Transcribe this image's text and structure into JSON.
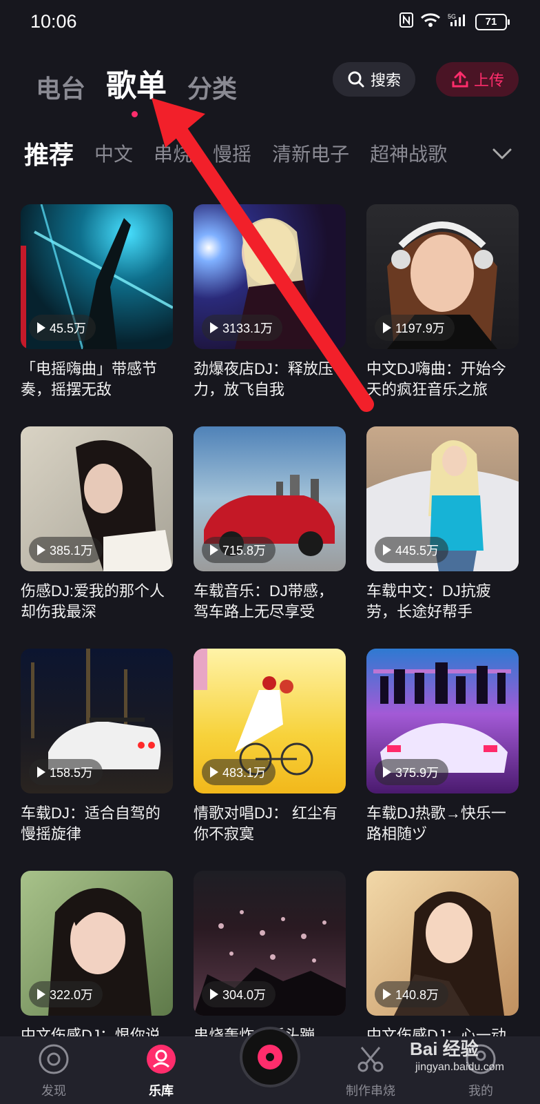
{
  "status": {
    "time": "10:06",
    "battery": "71"
  },
  "top_tabs": [
    "电台",
    "歌单",
    "分类"
  ],
  "search_label": "搜索",
  "upload_label": "上传",
  "categories": [
    "推荐",
    "中文",
    "串烧",
    "慢摇",
    "清新电子",
    "超神战歌"
  ],
  "cards": [
    {
      "count": "45.5万",
      "title": "「电摇嗨曲」带感节奏，摇摆无敌"
    },
    {
      "count": "3133.1万",
      "title": "劲爆夜店DJ：释放压力，放飞自我"
    },
    {
      "count": "1197.9万",
      "title": "中文DJ嗨曲：开始今天的疯狂音乐之旅"
    },
    {
      "count": "385.1万",
      "title": "伤感DJ:爱我的那个人却伤我最深"
    },
    {
      "count": "715.8万",
      "title": "车载音乐：DJ带感，驾车路上无尽享受"
    },
    {
      "count": "445.5万",
      "title": "车载中文：DJ抗疲劳，长途好帮手"
    },
    {
      "count": "158.5万",
      "title": "车载DJ：适合自驾的慢摇旋律"
    },
    {
      "count": "483.1万",
      "title": "情歌对唱DJ：  红尘有你不寂寞"
    },
    {
      "count": "375.9万",
      "title": "车载DJ热歌→快乐一路相随ヅ"
    },
    {
      "count": "322.0万",
      "title": "中文伤感DJ：恨你说"
    },
    {
      "count": "304.0万",
      "title": "串烧轰炸：摇头蹦"
    },
    {
      "count": "140.8万",
      "title": "中文伤感DJ：心一动"
    }
  ],
  "nav": [
    "发现",
    "乐库",
    "制作串烧",
    "我的"
  ],
  "watermark": {
    "brand": "Bai 经验",
    "url": "jingyan.baidu.com"
  },
  "colors": {
    "accent": "#ff2d6c",
    "background": "#17171e",
    "arrow": "#f2202a"
  }
}
